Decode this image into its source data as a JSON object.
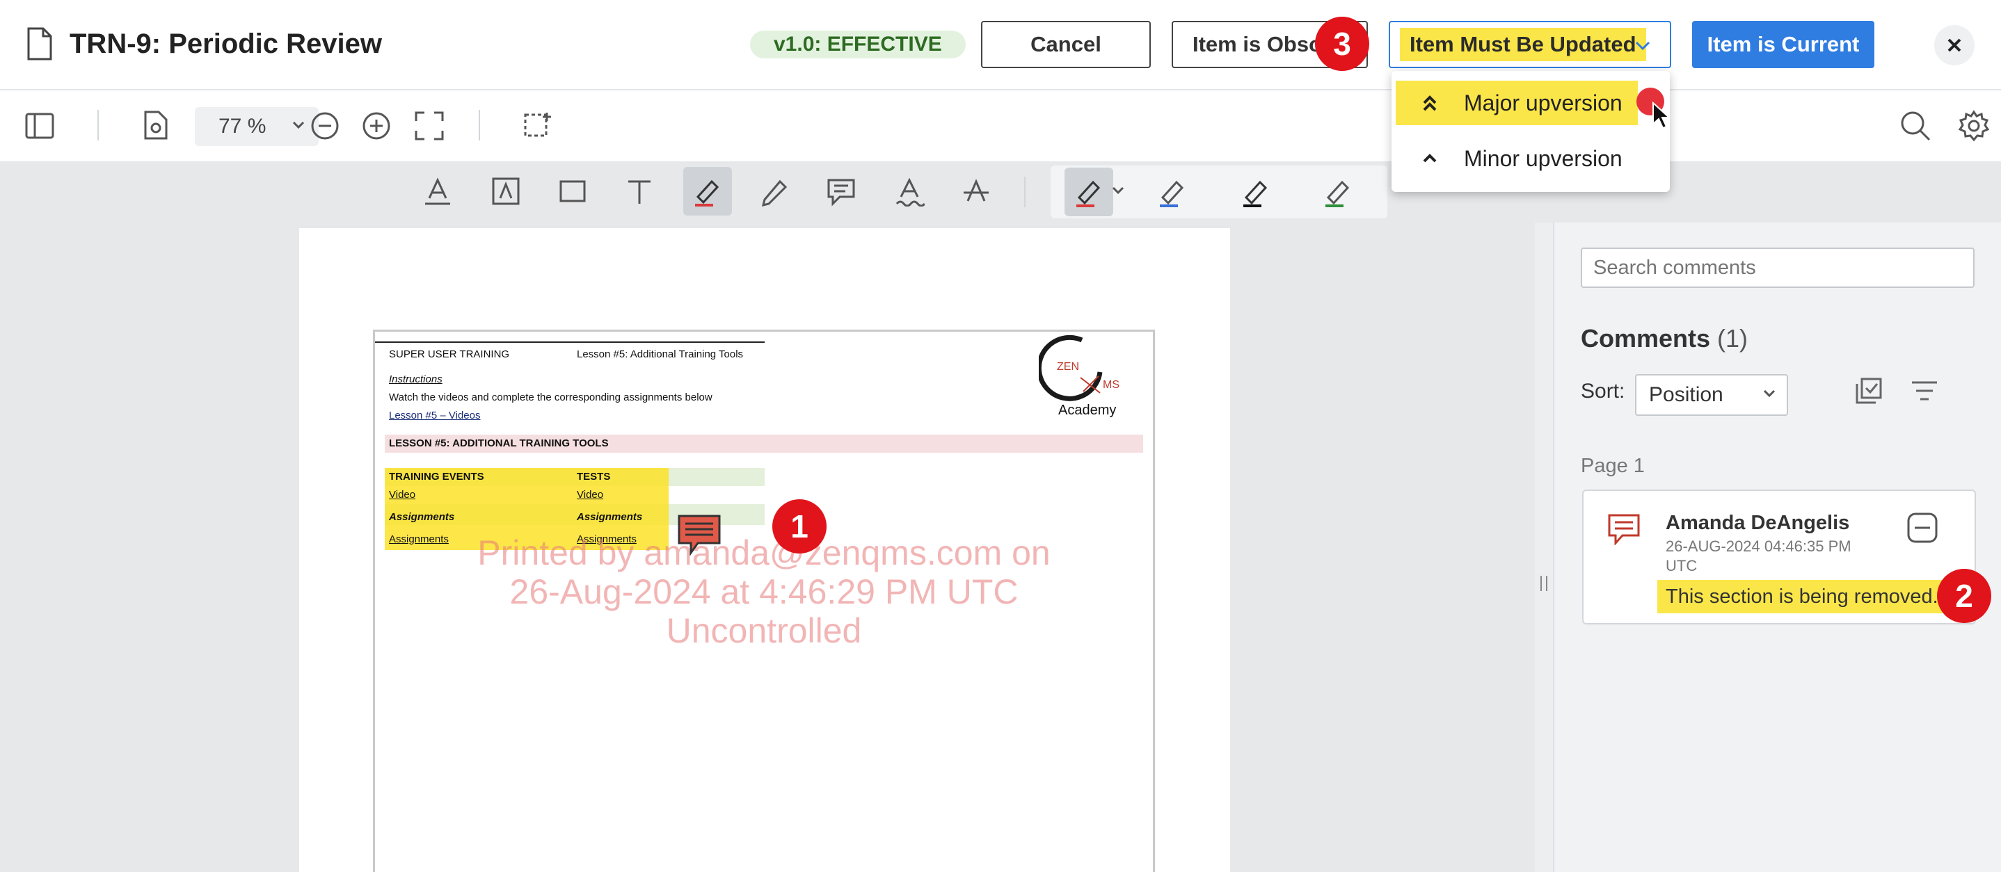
{
  "header": {
    "title": "TRN-9: Periodic Review",
    "status_badge": "v1.0: EFFECTIVE",
    "buttons": {
      "cancel": "Cancel",
      "obsolete": "Item is Obsolete",
      "must_update": "Item Must Be Updated",
      "current": "Item is Current"
    }
  },
  "dropdown": {
    "items": [
      {
        "label": "Major upversion",
        "icon": "double-chevron-up-icon"
      },
      {
        "label": "Minor upversion",
        "icon": "chevron-up-icon"
      }
    ]
  },
  "toolbar": {
    "zoom": "77 %"
  },
  "document": {
    "header_left": "SUPER USER TRAINING",
    "header_right": "Lesson #5: Additional Training Tools",
    "instructions_label": "Instructions",
    "instructions_text": "Watch the videos and complete the corresponding assignments below",
    "videos_link": "Lesson #5 – Videos",
    "logo_text_top": "ZEN",
    "logo_text_side": "MS",
    "logo_text_bottom": "Academy",
    "section_title": "LESSON #5: ADDITIONAL TRAINING TOOLS",
    "table": {
      "col1_header": "TRAINING EVENTS",
      "col2_header": "TESTS",
      "row1": [
        "Video",
        "Video"
      ],
      "row2": [
        "Assignments",
        "Assignments"
      ],
      "row3": [
        "Assignments",
        "Assignments"
      ]
    },
    "watermark": {
      "line1": "Printed by amanda@zenqms.com on",
      "line2": "26-Aug-2024 at 4:46:29 PM UTC",
      "line3": "Uncontrolled"
    }
  },
  "comments": {
    "search_placeholder": "Search comments",
    "heading": "Comments",
    "count": "(1)",
    "sort_label": "Sort:",
    "sort_value": "Position",
    "page_label": "Page 1",
    "items": [
      {
        "author": "Amanda DeAngelis",
        "date": "26-AUG-2024 04:46:35 PM UTC",
        "text": "This section is being removed."
      }
    ]
  },
  "step_badges": [
    "1",
    "2",
    "3"
  ],
  "colors": {
    "primary": "#2f7de1",
    "highlight": "#fbe64a",
    "badge_green_bg": "#e3f2df",
    "badge_green_text": "#2e6b22",
    "step_red": "#e0141a",
    "comment_icon": "#c0392b"
  }
}
